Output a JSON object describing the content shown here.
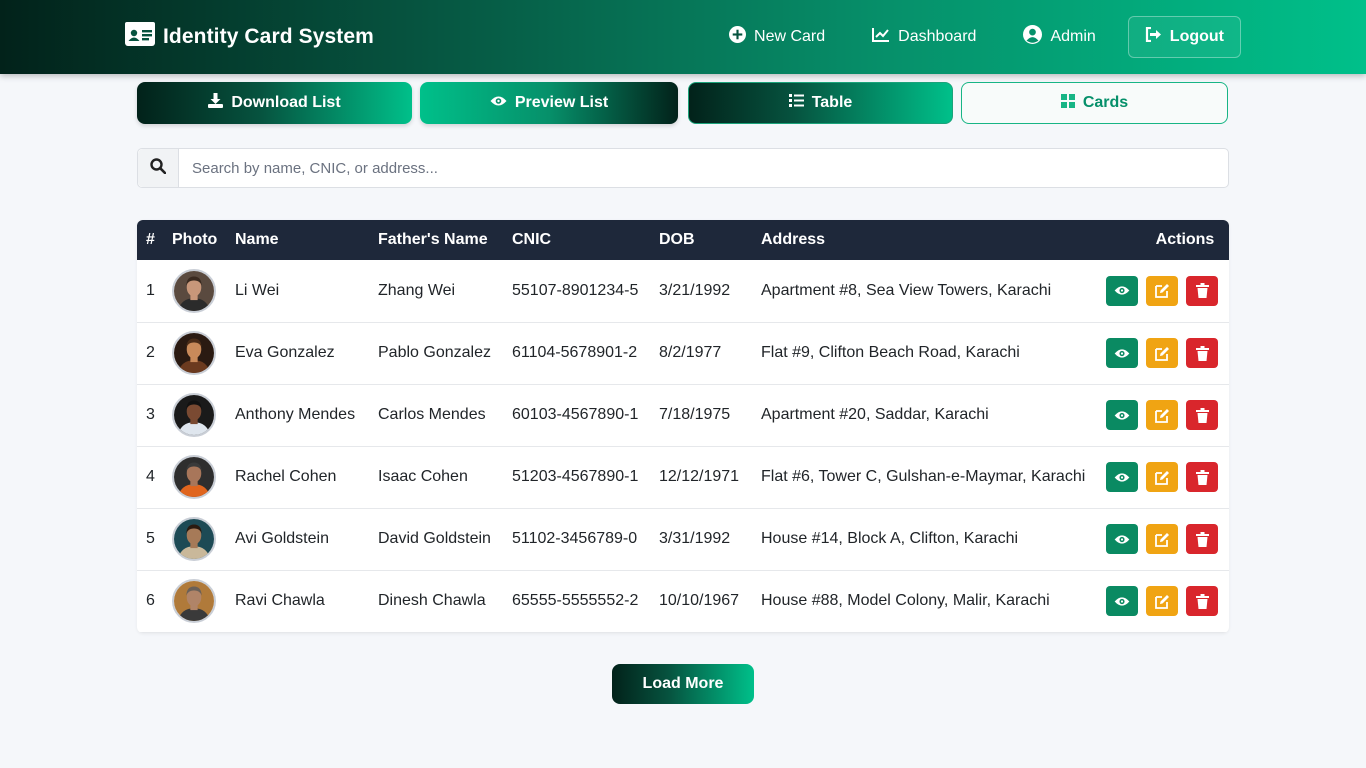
{
  "app": {
    "title": "Identity Card System"
  },
  "nav": {
    "new_card": "New Card",
    "dashboard": "Dashboard",
    "admin": "Admin",
    "logout": "Logout"
  },
  "toolbar": {
    "download": "Download List",
    "preview": "Preview List",
    "table": "Table",
    "cards": "Cards",
    "active_view": "Table"
  },
  "search": {
    "placeholder": "Search by name, CNIC, or address...",
    "value": ""
  },
  "table": {
    "headers": [
      "#",
      "Photo",
      "Name",
      "Father's Name",
      "CNIC",
      "DOB",
      "Address",
      "Actions"
    ],
    "rows": [
      {
        "num": "1",
        "name": "Li Wei",
        "father": "Zhang Wei",
        "cnic": "55107-8901234-5",
        "dob": "3/21/1992",
        "address": "Apartment #8, Sea View Towers, Karachi",
        "avatar": {
          "bg": "#5a4a3f",
          "skin": "#c8977a",
          "hair": "#3a2a20",
          "shirt": "#2b2b2b"
        }
      },
      {
        "num": "2",
        "name": "Eva Gonzalez",
        "father": "Pablo Gonzalez",
        "cnic": "61104-5678901-2",
        "dob": "8/2/1977",
        "address": "Flat #9, Clifton Beach Road, Karachi",
        "avatar": {
          "bg": "#2a1a12",
          "skin": "#c98a5a",
          "hair": "#4a2c18",
          "shirt": "#6b3a1f"
        }
      },
      {
        "num": "3",
        "name": "Anthony Mendes",
        "father": "Carlos Mendes",
        "cnic": "60103-4567890-1",
        "dob": "7/18/1975",
        "address": "Apartment #20, Saddar, Karachi",
        "avatar": {
          "bg": "#1a1a1a",
          "skin": "#7a4a32",
          "hair": "#111111",
          "shirt": "#dfe6ee"
        }
      },
      {
        "num": "4",
        "name": "Rachel Cohen",
        "father": "Isaac Cohen",
        "cnic": "51203-4567890-1",
        "dob": "12/12/1971",
        "address": "Flat #6, Tower C, Gulshan-e-Maymar, Karachi",
        "avatar": {
          "bg": "#2e2e2e",
          "skin": "#a8765a",
          "hair": "#3a3a3a",
          "shirt": "#e0651e"
        }
      },
      {
        "num": "5",
        "name": "Avi Goldstein",
        "father": "David Goldstein",
        "cnic": "51102-3456789-0",
        "dob": "3/31/1992",
        "address": "House #14, Block A, Clifton, Karachi",
        "avatar": {
          "bg": "#1d4a55",
          "skin": "#a67a58",
          "hair": "#2a1a10",
          "shirt": "#c9b89a"
        }
      },
      {
        "num": "6",
        "name": "Ravi Chawla",
        "father": "Dinesh Chawla",
        "cnic": "65555-5555552-2",
        "dob": "10/10/1967",
        "address": "House #88, Model Colony, Malir, Karachi",
        "avatar": {
          "bg": "#b07a3a",
          "skin": "#b08468",
          "hair": "#6a6058",
          "shirt": "#3a3a3a"
        }
      }
    ]
  },
  "load_more": "Load More",
  "colors": {
    "brand_dark": "#02221a",
    "brand_accent": "#00c08a",
    "table_header": "#1e283a",
    "view": "#0a8a62",
    "edit": "#f0a413",
    "delete": "#d9262c"
  },
  "icons": {
    "brand": "id-card-icon",
    "new_card": "plus-circle-icon",
    "dashboard": "chart-line-icon",
    "admin": "user-circle-icon",
    "logout": "sign-out-icon",
    "download": "download-icon",
    "preview": "eye-icon",
    "table": "list-icon",
    "cards": "grid-icon",
    "search": "search-icon",
    "view": "eye-icon",
    "edit": "edit-icon",
    "delete": "trash-icon"
  }
}
